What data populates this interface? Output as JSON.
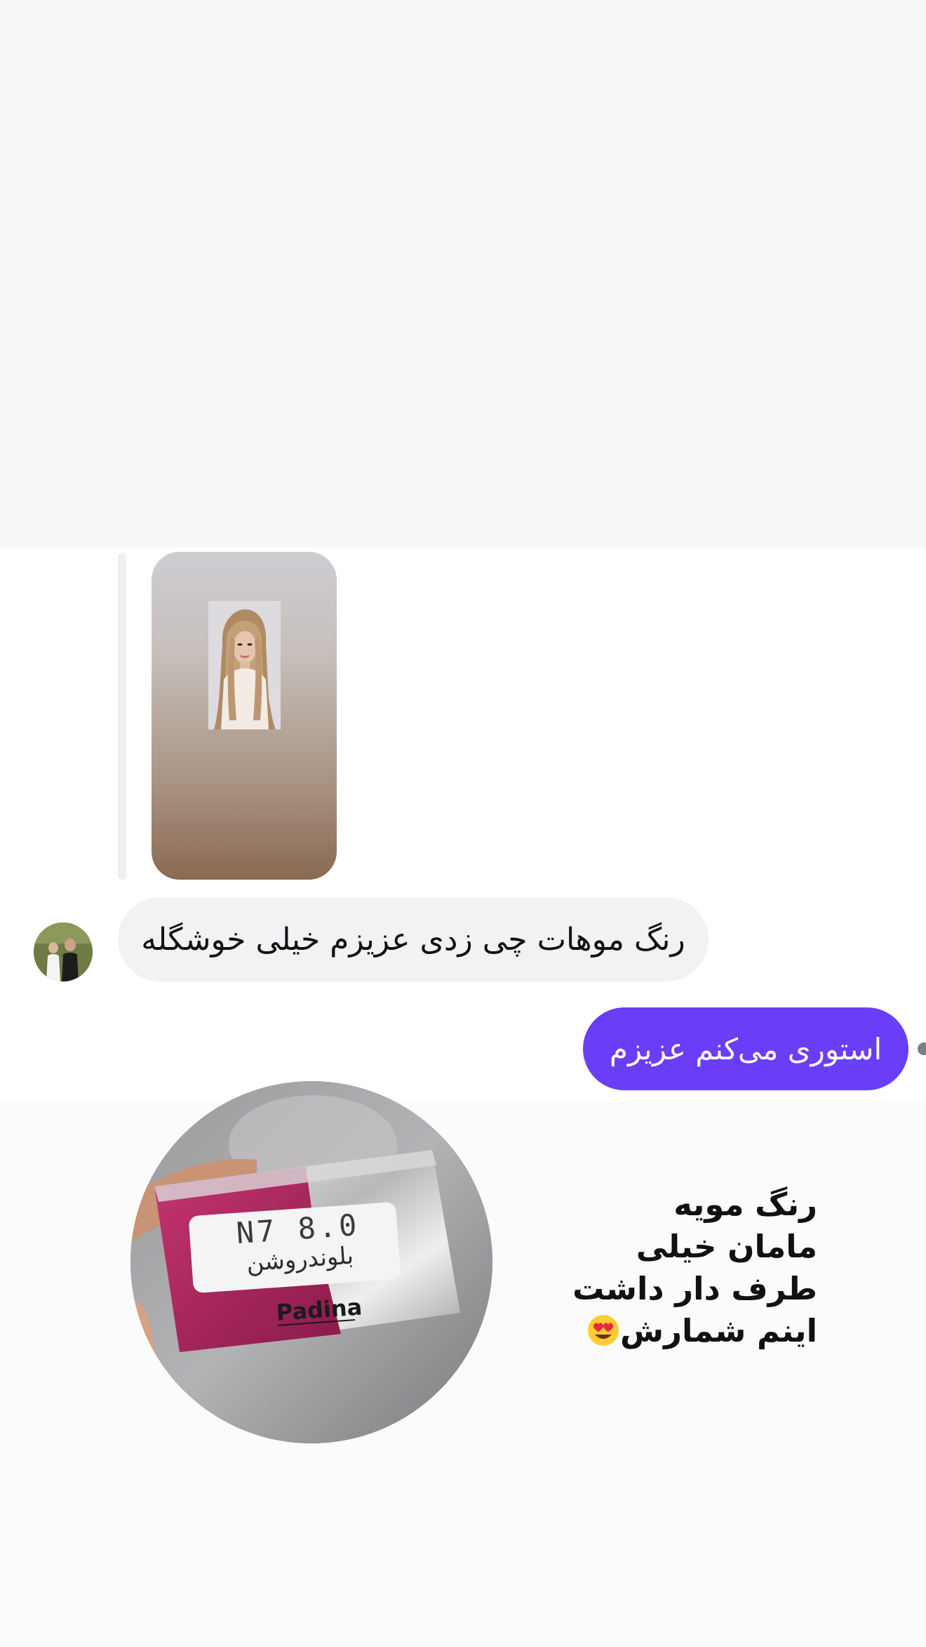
{
  "story_reply": {
    "thumbnail_icon": "story-photo-woman"
  },
  "incoming": {
    "avatar_icon": "avatar-couple-photo",
    "text": "رنگ موهات چی زدی عزیزم خیلی خوشگله"
  },
  "outgoing": {
    "text": "استوری می‌کنم عزیزم",
    "bubble_color": "#6a3ef6"
  },
  "shared_media": {
    "label_code": "N7 8.0",
    "label_shade": "بلوندروشن",
    "brand": "Padina",
    "caption_lines": [
      "رنگ مویه",
      "مامان خیلی",
      "طرف دار داشت",
      "اینم شمارش"
    ],
    "caption_emoji": "heart-eyes-emoji"
  }
}
